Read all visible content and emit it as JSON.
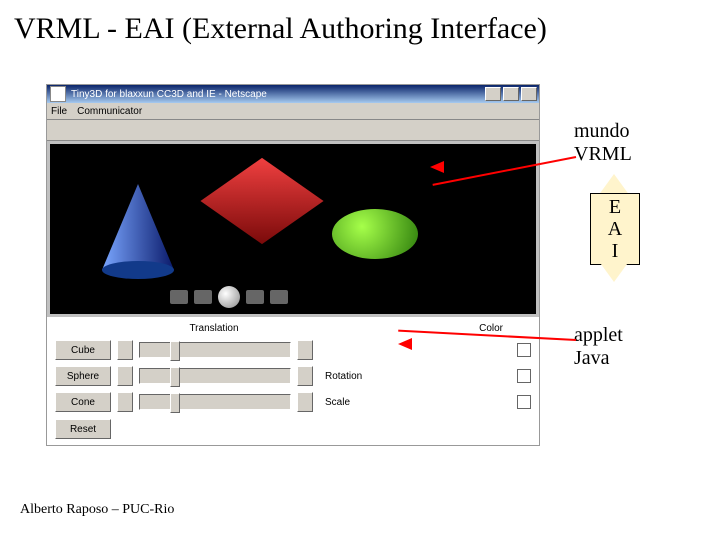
{
  "title": "VRML - EAI (External Authoring Interface)",
  "footer": "Alberto Raposo – PUC-Rio",
  "window": {
    "title": "Tiny3D for blaxxun CC3D and IE - Netscape",
    "menu": [
      "File",
      "Communicator"
    ]
  },
  "annotations": {
    "mundo_line1": "mundo",
    "mundo_line2": "VRML",
    "eai_e": "E",
    "eai_a": "A",
    "eai_i": "I",
    "applet_line1": "applet",
    "applet_line2": "Java"
  },
  "applet": {
    "col_mid": "Translation",
    "col_right": "Color",
    "rows": [
      {
        "btn": "Cube"
      },
      {
        "btn": "Sphere"
      },
      {
        "btn": "Cone"
      }
    ],
    "row2_label": "Rotation",
    "row3_label": "Scale",
    "reset": "Reset"
  }
}
